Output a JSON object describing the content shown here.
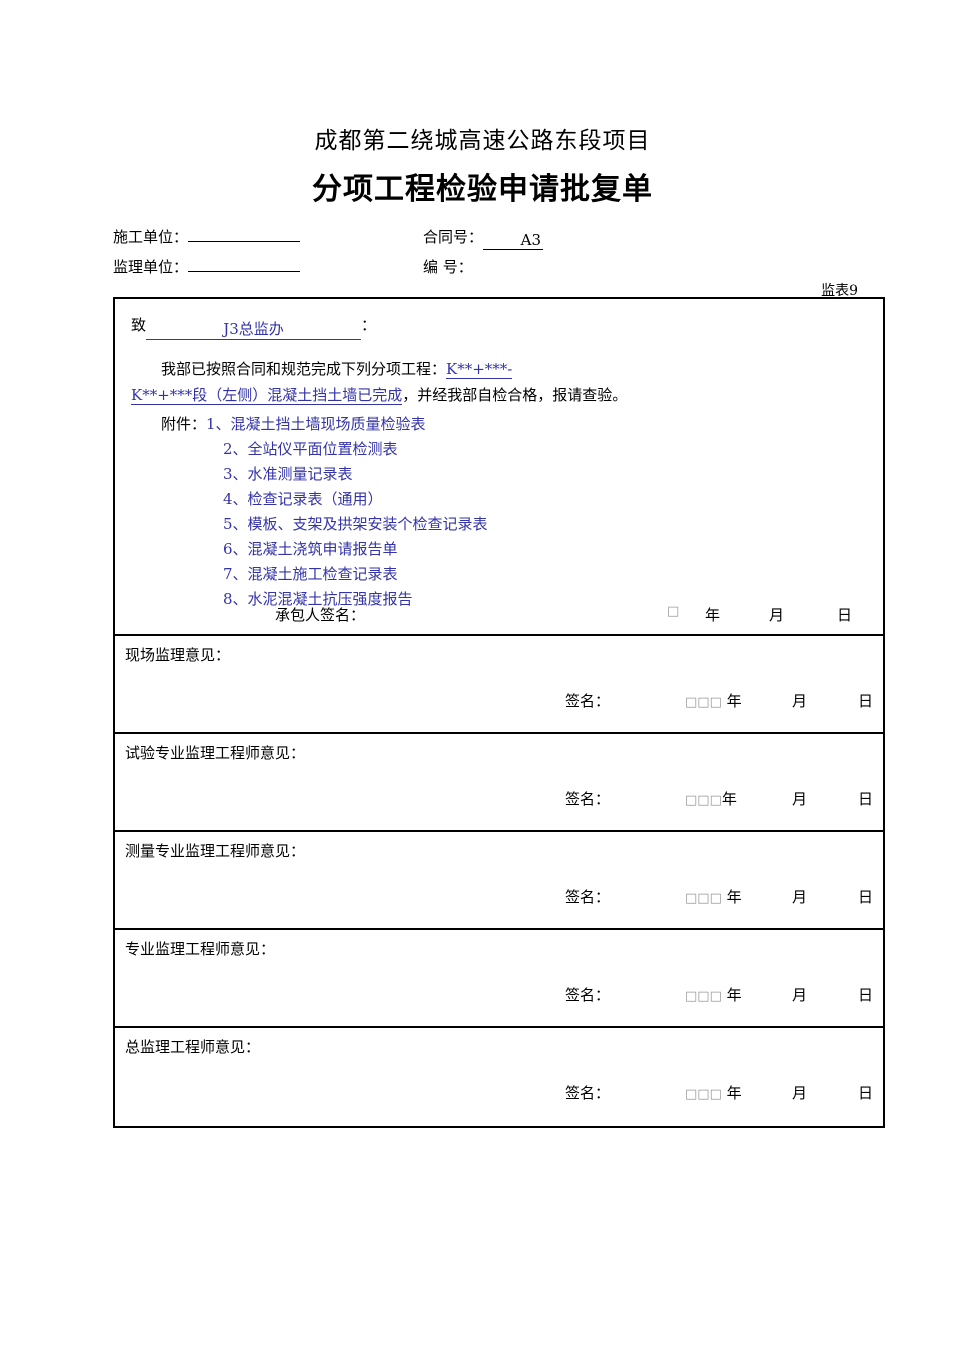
{
  "document": {
    "project_title": "成都第二绕城高速公路东段项目",
    "form_title": "分项工程检验申请批复单",
    "sheet_code": "监表9"
  },
  "header": {
    "contractor_label": "施工单位：",
    "contractor_value": "",
    "supervisor_label": "监理单位：",
    "supervisor_value": "",
    "contract_no_label": "合同号：",
    "contract_no_value": "A3",
    "serial_no_label": "编 号：",
    "serial_no_value": ""
  },
  "body": {
    "to_prefix": "致",
    "to_value": "J3总监办",
    "to_suffix": "：",
    "para_lead": "我部已按照合同和规范完成下列分项工程：",
    "para_blue_1": "K**+***-",
    "para_blue_2": "K**+***段（左侧）混凝土挡土墙已完成",
    "para_tail": "，并经我部自检合格，报请查验。",
    "attach_label": "附件：",
    "attachments": [
      "1、混凝土挡土墙现场质量检验表",
      "2、全站仪平面位置检测表",
      "3、水准测量记录表",
      "4、检查记录表（通用）",
      "5、模板、支架及拱架安装个检查记录表",
      "6、混凝土浇筑申请报告单",
      "7、混凝土施工检查记录表",
      "8、水泥混凝土抗压强度报告"
    ],
    "contractor_sign_label": "承包人签名：",
    "contractor_year_box": "□",
    "year_unit": "年",
    "month_unit": "月",
    "day_unit": "日"
  },
  "opinions": [
    {
      "label": "现场监理意见：",
      "sign_label": "签名：",
      "date_boxes": "□□□",
      "year_unit": "年",
      "month_unit": "月",
      "day_unit": "日"
    },
    {
      "label": "试验专业监理工程师意见：",
      "sign_label": "签名：",
      "date_boxes": "□□□",
      "year_unit": "年",
      "month_unit": "月",
      "day_unit": "日"
    },
    {
      "label": "测量专业监理工程师意见：",
      "sign_label": "签名：",
      "date_boxes": "□□□",
      "year_unit": "年",
      "month_unit": "月",
      "day_unit": "日"
    },
    {
      "label": "专业监理工程师意见：",
      "sign_label": "签名：",
      "date_boxes": "□□□",
      "year_unit": "年",
      "month_unit": "月",
      "day_unit": "日"
    },
    {
      "label": "总监理工程师意见：",
      "sign_label": "签名：",
      "date_boxes": "□□□",
      "year_unit": "年",
      "month_unit": "月",
      "day_unit": "日"
    }
  ],
  "colors": {
    "blue_text": "#3333aa",
    "black_text": "#000000",
    "border": "#000000"
  }
}
